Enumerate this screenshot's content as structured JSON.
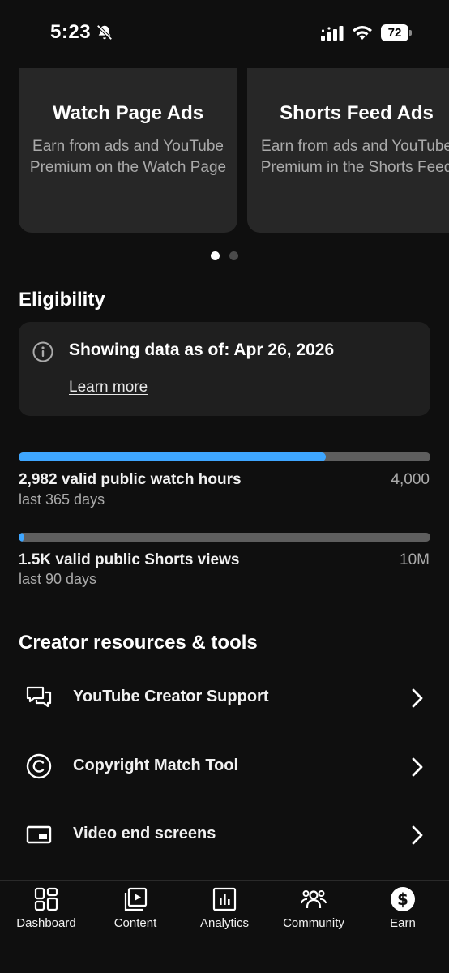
{
  "status_bar": {
    "time": "5:23",
    "battery": "72",
    "icons": [
      "bell-slash-icon",
      "cellular-signal-icon",
      "wifi-icon",
      "battery-icon"
    ]
  },
  "cards": [
    {
      "title": "Watch Page Ads",
      "description": "Earn from ads and YouTube Premium on the Watch Page"
    },
    {
      "title": "Shorts Feed Ads",
      "description": "Earn from ads and YouTube Premium in the Shorts Feed"
    }
  ],
  "carousel": {
    "active_index": 0,
    "count": 2
  },
  "eligibility": {
    "heading": "Eligibility",
    "info_text": "Showing data as of: Apr 26, 2026",
    "learn_more": "Learn more",
    "metrics": [
      {
        "label": "2,982 valid public watch hours",
        "period": "last 365 days",
        "goal": "4,000",
        "progress_fraction": 0.7455
      },
      {
        "label": "1.5K valid public Shorts views",
        "period": "last 90 days",
        "goal": "10M",
        "progress_fraction": 0.012
      }
    ]
  },
  "resources": {
    "heading": "Creator resources & tools",
    "items": [
      {
        "label": "YouTube Creator Support",
        "icon": "chat-bubbles-icon"
      },
      {
        "label": "Copyright Match Tool",
        "icon": "copyright-icon"
      },
      {
        "label": "Video end screens",
        "icon": "end-screen-icon"
      }
    ]
  },
  "bottom_nav": {
    "active": "Earn",
    "items": [
      {
        "label": "Dashboard",
        "icon": "dashboard-grid-icon"
      },
      {
        "label": "Content",
        "icon": "content-play-icon"
      },
      {
        "label": "Analytics",
        "icon": "analytics-chart-icon"
      },
      {
        "label": "Community",
        "icon": "community-people-icon"
      },
      {
        "label": "Earn",
        "icon": "earn-dollar-icon"
      }
    ]
  },
  "colors": {
    "background": "#0f0f0f",
    "card": "#272727",
    "progress_fill": "#3ea6ff",
    "progress_track": "#5e5e5e"
  }
}
